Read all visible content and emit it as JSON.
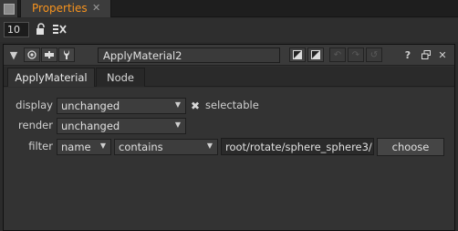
{
  "tabbar": {
    "tab_label": "Properties",
    "close_glyph": "✕"
  },
  "toolbar": {
    "max_panels": "10",
    "icons": [
      "lock-icon",
      "clear-panels-icon"
    ]
  },
  "panel": {
    "node_name": "ApplyMaterial2",
    "header_icons": [
      "collapse-arrow-icon",
      "centre-node-icon",
      "float-panel-icon",
      "help-wrench-icon",
      "undo-icon",
      "redo-icon",
      "revert-icon",
      "help-question-icon",
      "float-icon",
      "close-icon"
    ],
    "help_glyph": "?",
    "close_glyph": "✕"
  },
  "knob_tabs": {
    "tabs": [
      {
        "label": "ApplyMaterial"
      },
      {
        "label": "Node"
      }
    ]
  },
  "knobs": {
    "display": {
      "label": "display",
      "value": "unchanged"
    },
    "selectable": {
      "label": "selectable",
      "checked": true
    },
    "render": {
      "label": "render",
      "value": "unchanged"
    },
    "filter": {
      "label": "filter",
      "field": "name",
      "operator": "contains",
      "path": "root/rotate/sphere_sphere3/",
      "choose_label": "choose"
    }
  },
  "colors": {
    "accent": "#f7931e",
    "background": "#2b2b2b",
    "panel": "#333333"
  }
}
